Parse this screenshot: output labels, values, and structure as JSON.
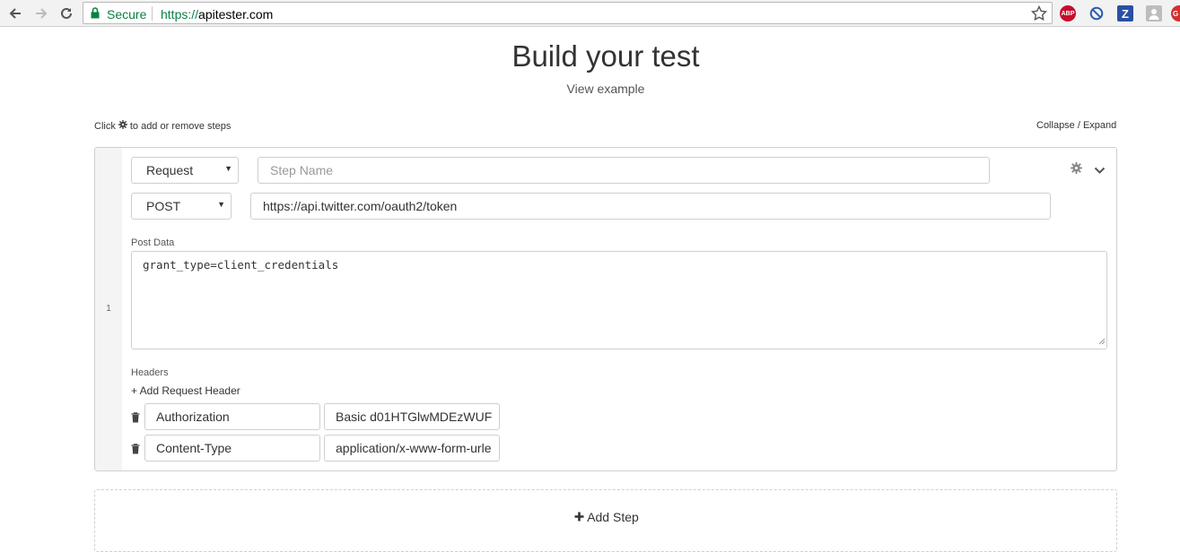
{
  "browser": {
    "secure_label": "Secure",
    "url_scheme": "https://",
    "url_host": "apitester.com",
    "extensions": [
      {
        "name": "adblock-plus",
        "label": "ABP",
        "color": "#c70d2c"
      },
      {
        "name": "blocker",
        "label": "",
        "color": "#2a5db0"
      },
      {
        "name": "zotero",
        "label": "Z",
        "color": "#2a4fa3"
      },
      {
        "name": "profile",
        "label": "",
        "color": "#9e9e9e"
      },
      {
        "name": "extension-red",
        "label": "G",
        "color": "#d32f2f"
      }
    ]
  },
  "page": {
    "title": "Build your test",
    "view_example": "View example",
    "hint_prefix": "Click",
    "hint_suffix": "to add or remove steps",
    "collapse_expand": "Collapse / Expand"
  },
  "step": {
    "number": "1",
    "type_select": "Request",
    "step_name_placeholder": "Step Name",
    "method_select": "POST",
    "url": "https://api.twitter.com/oauth2/token",
    "post_data_label": "Post Data",
    "post_data": "grant_type=client_credentials",
    "headers_label": "Headers",
    "add_header_label": "+ Add Request Header",
    "headers": [
      {
        "name": "Authorization",
        "value": "Basic d01HTGlwMDEzWUF"
      },
      {
        "name": "Content-Type",
        "value": "application/x-www-form-urle"
      }
    ]
  },
  "add_step_label": "Add Step"
}
